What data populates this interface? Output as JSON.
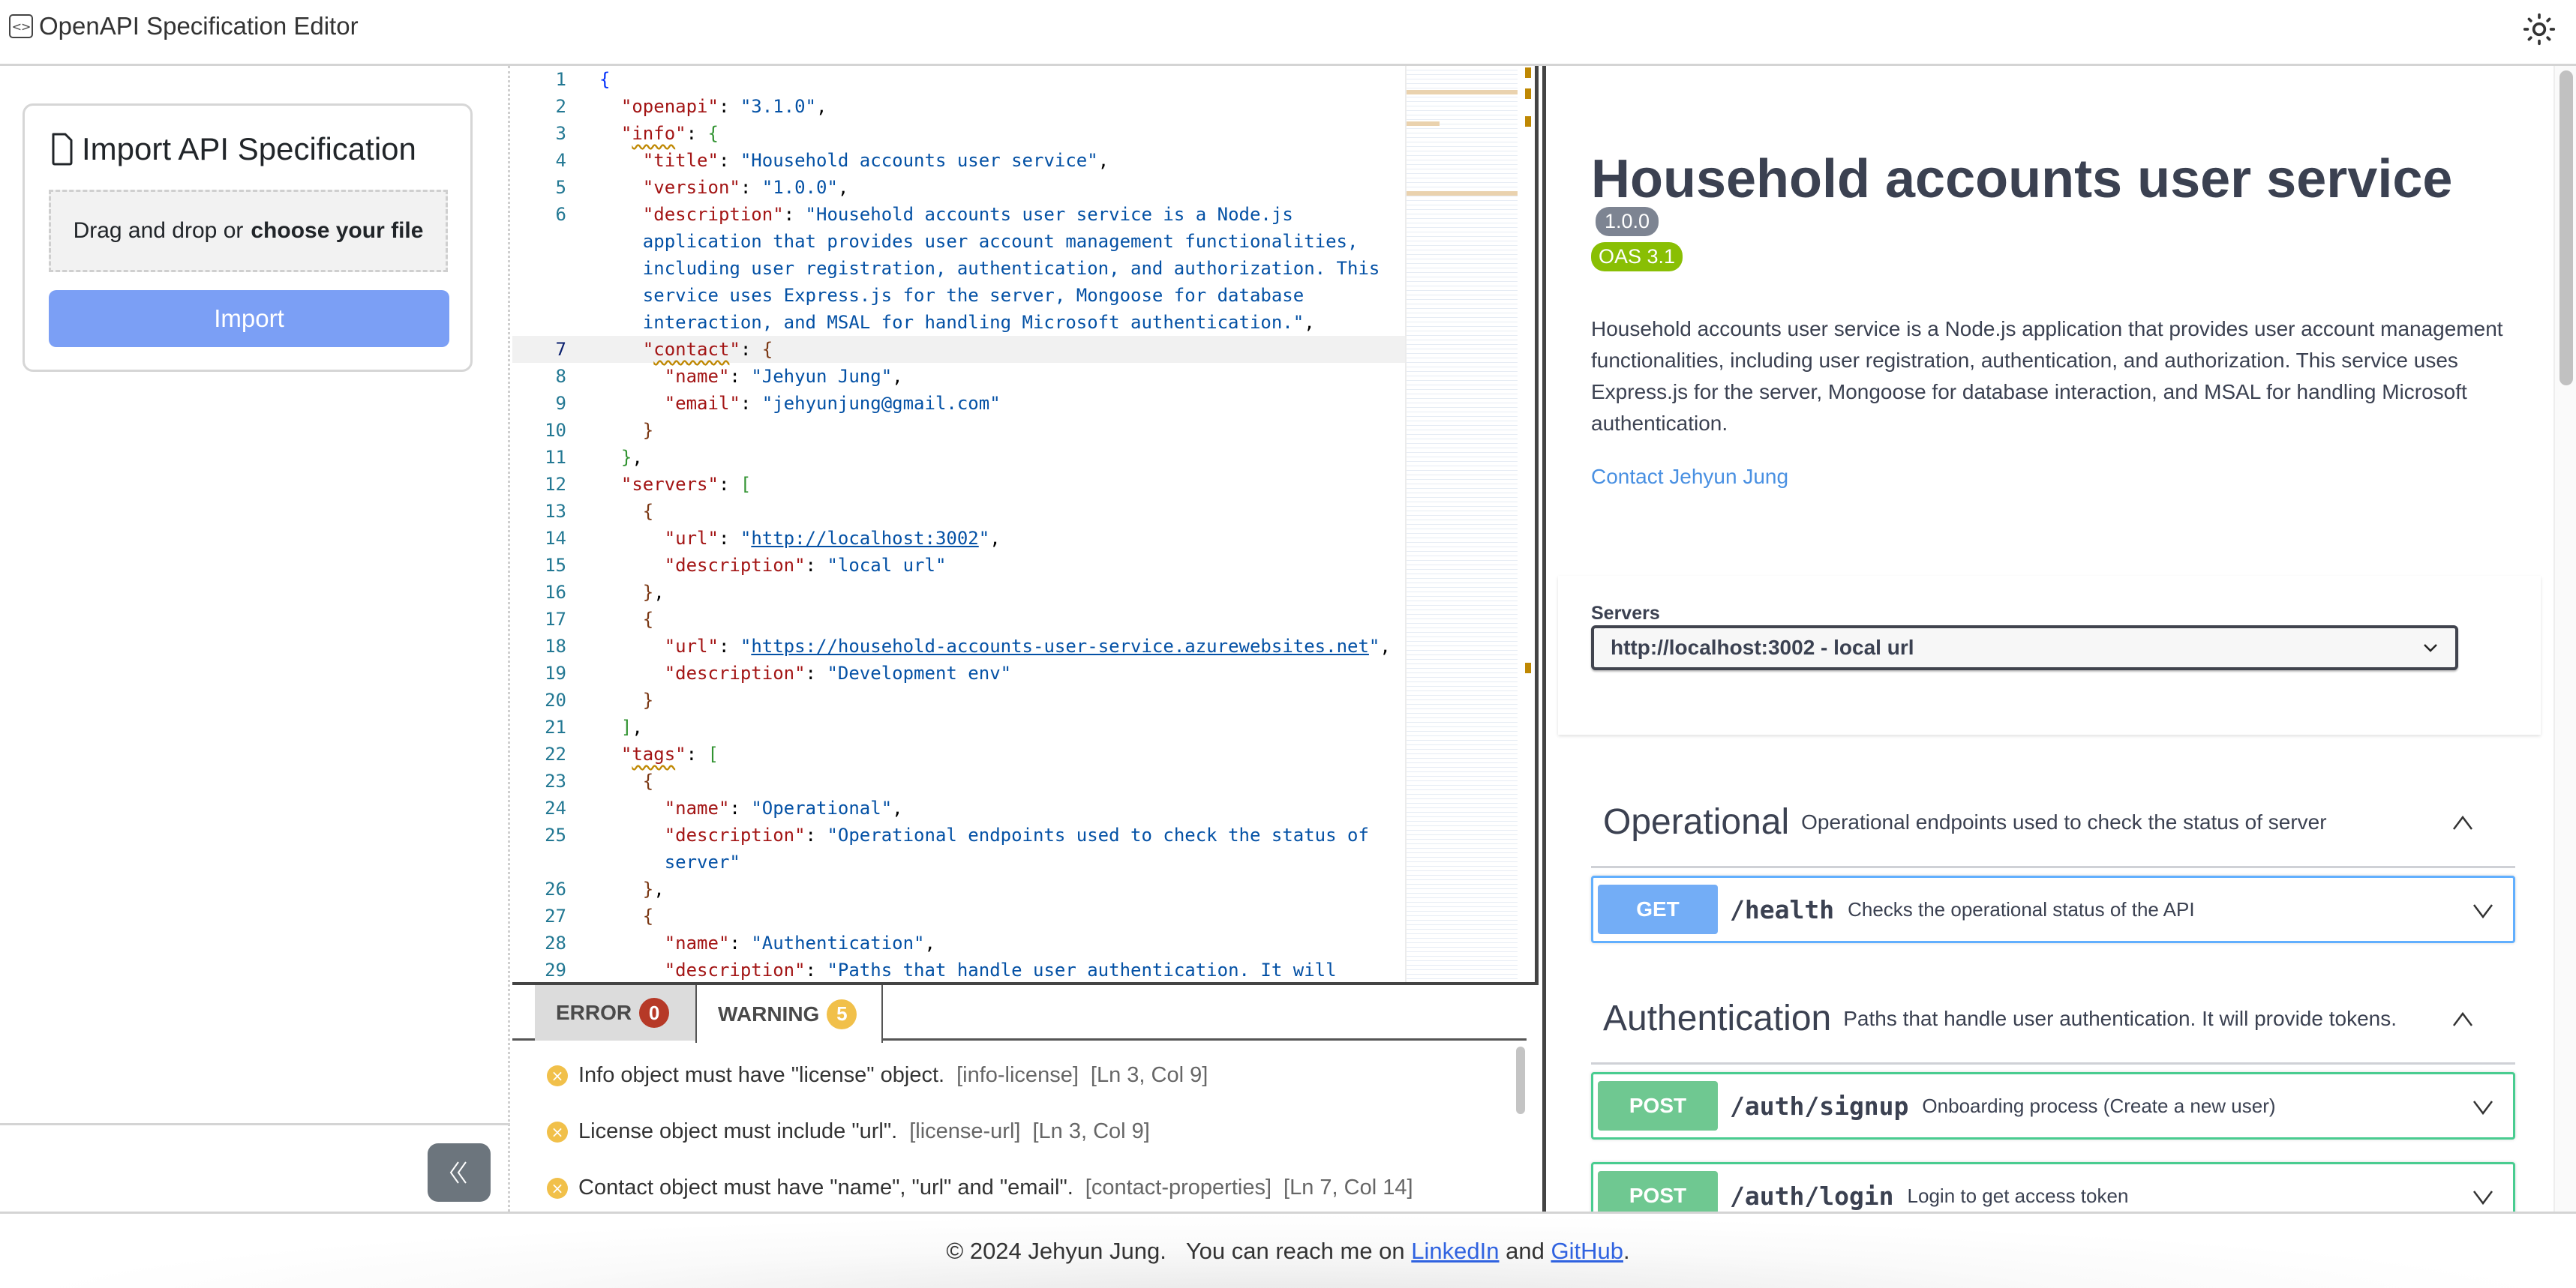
{
  "header": {
    "title": "OpenAPI Specification Editor",
    "app_icon": "code-brackets-icon",
    "theme_toggle_icon": "sun-icon"
  },
  "sidebar": {
    "import_card": {
      "title": "Import API Specification",
      "title_icon": "file-icon",
      "dropzone_prefix": "Drag and drop or",
      "dropzone_action": "choose your file",
      "import_button": "Import"
    },
    "collapse_button_icon": "double-chevron-left-icon"
  },
  "editor": {
    "current_line": 7,
    "lines": [
      {
        "n": "1",
        "parts": [
          [
            "b1",
            "{"
          ]
        ]
      },
      {
        "n": "2",
        "parts": [
          [
            "ind",
            "  "
          ],
          [
            "key",
            "\"openapi\""
          ],
          [
            "punct",
            ": "
          ],
          [
            "str",
            "\"3.1.0\""
          ],
          [
            "punct",
            ","
          ]
        ]
      },
      {
        "n": "3",
        "parts": [
          [
            "ind",
            "  "
          ],
          [
            "key",
            "\""
          ],
          [
            "keysq",
            "info"
          ],
          [
            "key",
            "\""
          ],
          [
            "punct",
            ": "
          ],
          [
            "b2",
            "{"
          ]
        ]
      },
      {
        "n": "4",
        "parts": [
          [
            "ind",
            "    "
          ],
          [
            "key",
            "\"title\""
          ],
          [
            "punct",
            ": "
          ],
          [
            "str",
            "\"Household accounts user service\""
          ],
          [
            "punct",
            ","
          ]
        ]
      },
      {
        "n": "5",
        "parts": [
          [
            "ind",
            "    "
          ],
          [
            "key",
            "\"version\""
          ],
          [
            "punct",
            ": "
          ],
          [
            "str",
            "\"1.0.0\""
          ],
          [
            "punct",
            ","
          ]
        ]
      },
      {
        "n": "6",
        "parts": [
          [
            "ind",
            "    "
          ],
          [
            "key",
            "\"description\""
          ],
          [
            "punct",
            ": "
          ],
          [
            "str",
            "\"Household accounts user service is a Node.js"
          ]
        ]
      },
      {
        "n": "",
        "parts": [
          [
            "ind",
            "    "
          ],
          [
            "str",
            "application that provides user account management functionalities,"
          ]
        ]
      },
      {
        "n": "",
        "parts": [
          [
            "ind",
            "    "
          ],
          [
            "str",
            "including user registration, authentication, and authorization. This"
          ]
        ]
      },
      {
        "n": "",
        "parts": [
          [
            "ind",
            "    "
          ],
          [
            "str",
            "service uses Express.js for the server, Mongoose for database"
          ]
        ]
      },
      {
        "n": "",
        "parts": [
          [
            "ind",
            "    "
          ],
          [
            "str",
            "interaction, and MSAL for handling Microsoft authentication.\""
          ],
          [
            "punct",
            ","
          ]
        ]
      },
      {
        "n": "7",
        "parts": [
          [
            "ind",
            "    "
          ],
          [
            "key",
            "\""
          ],
          [
            "keysq",
            "contact"
          ],
          [
            "key",
            "\""
          ],
          [
            "punct",
            ": "
          ],
          [
            "b3",
            "{"
          ]
        ]
      },
      {
        "n": "8",
        "parts": [
          [
            "ind",
            "      "
          ],
          [
            "key",
            "\"name\""
          ],
          [
            "punct",
            ": "
          ],
          [
            "str",
            "\"Jehyun Jung\""
          ],
          [
            "punct",
            ","
          ]
        ]
      },
      {
        "n": "9",
        "parts": [
          [
            "ind",
            "      "
          ],
          [
            "key",
            "\"email\""
          ],
          [
            "punct",
            ": "
          ],
          [
            "str",
            "\"jehyunjung@gmail.com\""
          ]
        ]
      },
      {
        "n": "10",
        "parts": [
          [
            "ind",
            "    "
          ],
          [
            "b3",
            "}"
          ]
        ]
      },
      {
        "n": "11",
        "parts": [
          [
            "ind",
            "  "
          ],
          [
            "b2",
            "}"
          ],
          [
            "punct",
            ","
          ]
        ]
      },
      {
        "n": "12",
        "parts": [
          [
            "ind",
            "  "
          ],
          [
            "key",
            "\"servers\""
          ],
          [
            "punct",
            ": "
          ],
          [
            "b2",
            "["
          ]
        ]
      },
      {
        "n": "13",
        "parts": [
          [
            "ind",
            "    "
          ],
          [
            "b3",
            "{"
          ]
        ]
      },
      {
        "n": "14",
        "parts": [
          [
            "ind",
            "      "
          ],
          [
            "key",
            "\"url\""
          ],
          [
            "punct",
            ": "
          ],
          [
            "str",
            "\""
          ],
          [
            "link",
            "http://localhost:3002"
          ],
          [
            "str",
            "\""
          ],
          [
            "punct",
            ","
          ]
        ]
      },
      {
        "n": "15",
        "parts": [
          [
            "ind",
            "      "
          ],
          [
            "key",
            "\"description\""
          ],
          [
            "punct",
            ": "
          ],
          [
            "str",
            "\"local url\""
          ]
        ]
      },
      {
        "n": "16",
        "parts": [
          [
            "ind",
            "    "
          ],
          [
            "b3",
            "}"
          ],
          [
            "punct",
            ","
          ]
        ]
      },
      {
        "n": "17",
        "parts": [
          [
            "ind",
            "    "
          ],
          [
            "b3",
            "{"
          ]
        ]
      },
      {
        "n": "18",
        "parts": [
          [
            "ind",
            "      "
          ],
          [
            "key",
            "\"url\""
          ],
          [
            "punct",
            ": "
          ],
          [
            "str",
            "\""
          ],
          [
            "link",
            "https://household-accounts-user-service.azurewebsites.net"
          ],
          [
            "str",
            "\""
          ],
          [
            "punct",
            ","
          ]
        ]
      },
      {
        "n": "19",
        "parts": [
          [
            "ind",
            "      "
          ],
          [
            "key",
            "\"description\""
          ],
          [
            "punct",
            ": "
          ],
          [
            "str",
            "\"Development env\""
          ]
        ]
      },
      {
        "n": "20",
        "parts": [
          [
            "ind",
            "    "
          ],
          [
            "b3",
            "}"
          ]
        ]
      },
      {
        "n": "21",
        "parts": [
          [
            "ind",
            "  "
          ],
          [
            "b2",
            "]"
          ],
          [
            "punct",
            ","
          ]
        ]
      },
      {
        "n": "22",
        "parts": [
          [
            "ind",
            "  "
          ],
          [
            "key",
            "\""
          ],
          [
            "keysq",
            "tags"
          ],
          [
            "key",
            "\""
          ],
          [
            "punct",
            ": "
          ],
          [
            "b2",
            "["
          ]
        ]
      },
      {
        "n": "23",
        "parts": [
          [
            "ind",
            "    "
          ],
          [
            "b3",
            "{"
          ]
        ]
      },
      {
        "n": "24",
        "parts": [
          [
            "ind",
            "      "
          ],
          [
            "key",
            "\"name\""
          ],
          [
            "punct",
            ": "
          ],
          [
            "str",
            "\"Operational\""
          ],
          [
            "punct",
            ","
          ]
        ]
      },
      {
        "n": "25",
        "parts": [
          [
            "ind",
            "      "
          ],
          [
            "key",
            "\"description\""
          ],
          [
            "punct",
            ": "
          ],
          [
            "str",
            "\"Operational endpoints used to check the status of"
          ]
        ]
      },
      {
        "n": "",
        "parts": [
          [
            "ind",
            "      "
          ],
          [
            "str",
            "server\""
          ]
        ]
      },
      {
        "n": "26",
        "parts": [
          [
            "ind",
            "    "
          ],
          [
            "b3",
            "}"
          ],
          [
            "punct",
            ","
          ]
        ]
      },
      {
        "n": "27",
        "parts": [
          [
            "ind",
            "    "
          ],
          [
            "b3",
            "{"
          ]
        ]
      },
      {
        "n": "28",
        "parts": [
          [
            "ind",
            "      "
          ],
          [
            "key",
            "\"name\""
          ],
          [
            "punct",
            ": "
          ],
          [
            "str",
            "\"Authentication\""
          ],
          [
            "punct",
            ","
          ]
        ]
      },
      {
        "n": "29",
        "parts": [
          [
            "ind",
            "      "
          ],
          [
            "key",
            "\"description\""
          ],
          [
            "punct",
            ": "
          ],
          [
            "str",
            "\"Paths that handle user authentication. It will"
          ]
        ]
      }
    ]
  },
  "problems": {
    "tabs": [
      {
        "label": "ERROR",
        "count": "0",
        "color": "#b63927",
        "active": false
      },
      {
        "label": "WARNING",
        "count": "5",
        "color": "#f1c04a",
        "active": true
      }
    ],
    "items": [
      {
        "message": "Info object must have \"license\" object.",
        "code": "[info-license]",
        "location": "[Ln 3, Col 9]"
      },
      {
        "message": "License object must include \"url\".",
        "code": "[license-url]",
        "location": "[Ln 3, Col 9]"
      },
      {
        "message": "Contact object must have \"name\", \"url\" and \"email\".",
        "code": "[contact-properties]",
        "location": "[Ln 7, Col 14]"
      }
    ]
  },
  "preview": {
    "title": "Household accounts user service",
    "version": "1.0.0",
    "oas_badge": "OAS 3.1",
    "description": "Household accounts user service is a Node.js application that provides user account management functionalities, including user registration, authentication, and authorization. This service uses Express.js for the server, Mongoose for database interaction, and MSAL for handling Microsoft authentication.",
    "contact_link": "Contact Jehyun Jung",
    "servers_label": "Servers",
    "servers_selected": "http://localhost:3002 - local url",
    "tags": [
      {
        "name": "Operational",
        "description": "Operational endpoints used to check the status of server",
        "operations": [
          {
            "method": "GET",
            "path": "/health",
            "summary": "Checks the operational status of the API"
          }
        ]
      },
      {
        "name": "Authentication",
        "description": "Paths that handle user authentication. It will provide tokens.",
        "operations": [
          {
            "method": "POST",
            "path": "/auth/signup",
            "summary": "Onboarding process (Create a new user)"
          },
          {
            "method": "POST",
            "path": "/auth/login",
            "summary": "Login to get access token"
          }
        ]
      }
    ],
    "colors": {
      "get": "#61affe",
      "post": "#49cc90",
      "oas": "#89bf04",
      "version": "#7d8492",
      "link": "#4990e2"
    }
  },
  "footer": {
    "copyright": "© 2024 Jehyun Jung.",
    "reach_text": "You can reach me on",
    "linkedin": "LinkedIn",
    "and": "and",
    "github": "GitHub",
    "period": "."
  }
}
